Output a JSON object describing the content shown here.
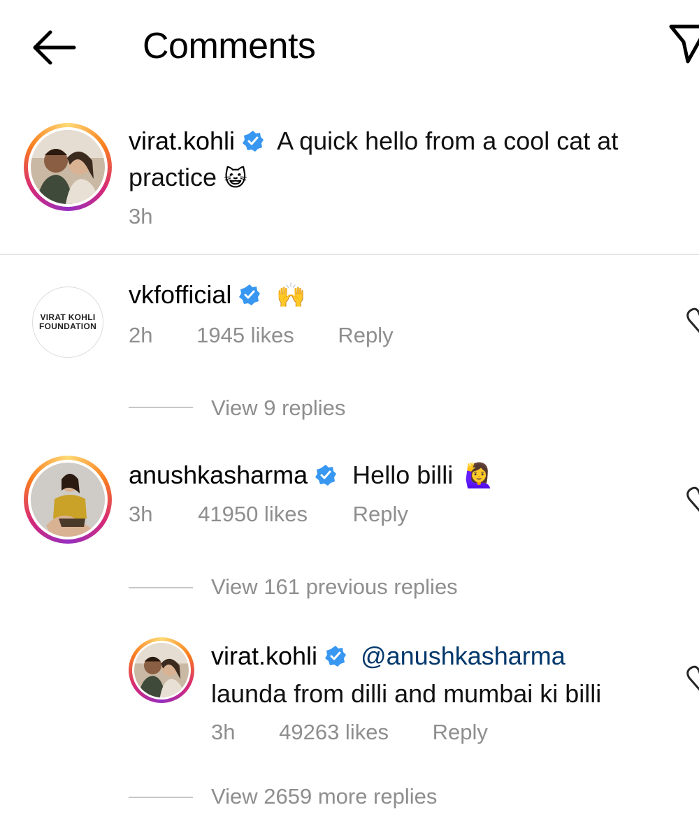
{
  "header": {
    "title": "Comments",
    "back_icon": "arrow-left-icon",
    "share_icon": "paper-plane-icon"
  },
  "caption": {
    "username": "virat.kohli",
    "verified": true,
    "text_line1": "A quick hello from a cool cat at",
    "text_line2": "practice",
    "emoji": "😺",
    "time": "3h"
  },
  "comments": [
    {
      "username": "vkfofficial",
      "avatar_label_top": "VIRAT KOHLI",
      "avatar_label_bottom": "FOUNDATION",
      "emoji": "🙌",
      "time": "2h",
      "likes": "1945 likes",
      "reply_label": "Reply",
      "view_replies": "View 9 replies"
    },
    {
      "username": "anushkasharma",
      "text": "Hello billi",
      "emoji": "🙋‍♀️",
      "time": "3h",
      "likes": "41950 likes",
      "reply_label": "Reply",
      "view_replies": "View 161 previous replies"
    }
  ],
  "reply": {
    "username": "virat.kohli",
    "mention": "@anushkasharma",
    "text": "launda from dilli and mumbai ki billi",
    "time": "3h",
    "likes": "49263 likes",
    "reply_label": "Reply",
    "view_more": "View 2659 more replies"
  },
  "colors": {
    "verified": "#3897f0",
    "muted": "#8e8e8e",
    "mention": "#00376b"
  }
}
